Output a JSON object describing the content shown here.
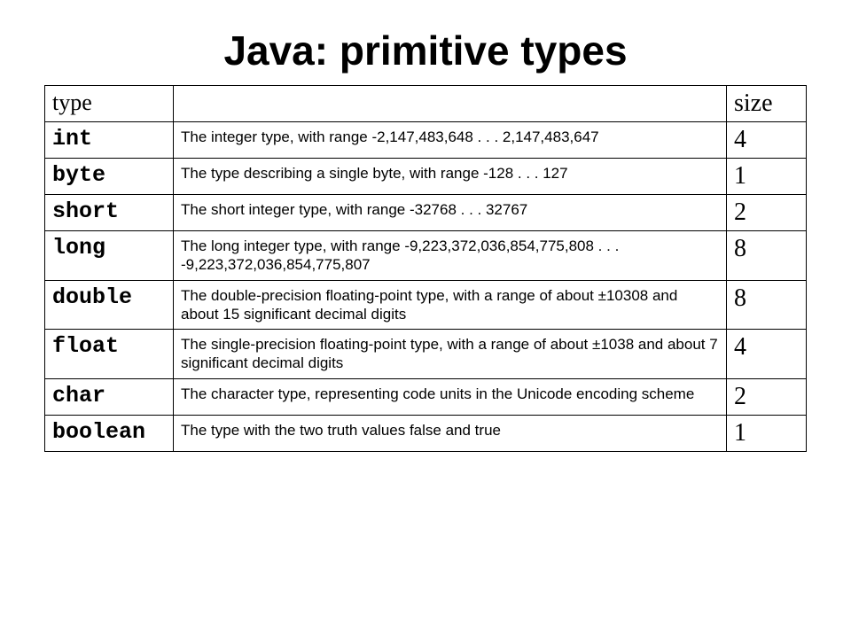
{
  "title": "Java: primitive types",
  "headers": {
    "type": "type",
    "desc": "",
    "size": "size"
  },
  "rows": [
    {
      "type": "int",
      "desc": "The integer type, with range -2,147,483,648 . . . 2,147,483,647",
      "size": "4"
    },
    {
      "type": "byte",
      "desc": "The type describing a single byte, with range -128 . . . 127",
      "size": "1"
    },
    {
      "type": "short",
      "desc": "The short integer type, with range -32768 . . . 32767",
      "size": "2"
    },
    {
      "type": "long",
      "desc": "The long integer type, with range -9,223,372,036,854,775,808 . . . -9,223,372,036,854,775,807",
      "size": "8"
    },
    {
      "type": "double",
      "desc": "The double-precision floating-point type, with a range of about ±10308 and about 15 significant decimal digits",
      "size": "8"
    },
    {
      "type": "float",
      "desc": "The single-precision floating-point type, with a range of about ±1038 and about 7 significant decimal digits",
      "size": "4"
    },
    {
      "type": "char",
      "desc": "The character type, representing code units in the Unicode encoding scheme",
      "size": "2"
    },
    {
      "type": "boolean",
      "desc": "The type with the two truth values false and true",
      "size": "1"
    }
  ]
}
